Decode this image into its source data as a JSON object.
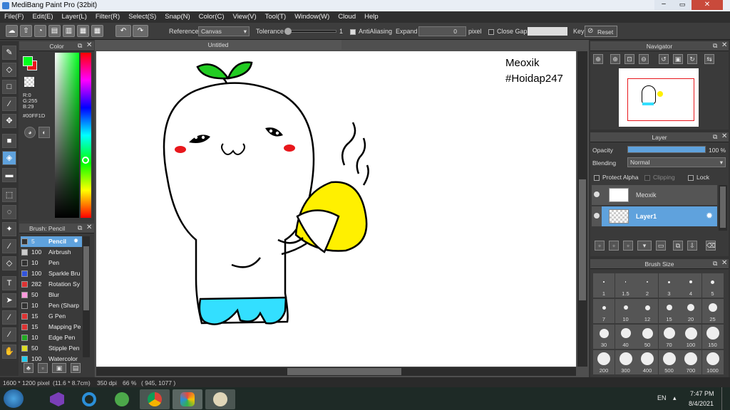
{
  "window": {
    "title": "MediBang Paint Pro (32bit)"
  },
  "menu": [
    "File(F)",
    "Edit(E)",
    "Layer(L)",
    "Filter(R)",
    "Select(S)",
    "Snap(N)",
    "Color(C)",
    "View(V)",
    "Tool(T)",
    "Window(W)",
    "Cloud",
    "Help"
  ],
  "toolbar": {
    "reference_label": "Reference",
    "reference_value": "Canvas",
    "tolerance_label": "Tolerance",
    "tolerance_value": "1",
    "antialiasing_label": "AntiAliasing",
    "expand_label": "Expand",
    "expand_value": "0",
    "expand_unit": "pixel",
    "close_gaps_label": "Close Gaps",
    "key_label": "Key",
    "reset_label": "Reset"
  },
  "color_panel": {
    "title": "Color",
    "r": "R:0",
    "g": "G:255",
    "b": "B:29",
    "hex": "#00FF1D",
    "primary_color": "#00FF1D",
    "secondary_color": "#E8171C"
  },
  "brush_panel": {
    "title": "Brush: Pencil",
    "items": [
      {
        "size": "5",
        "name": "Pencil",
        "color": "#333333"
      },
      {
        "size": "100",
        "name": "Airbrush",
        "color": "#cccccc"
      },
      {
        "size": "10",
        "name": "Pen",
        "color": "#333333"
      },
      {
        "size": "100",
        "name": "Sparkle Bru",
        "color": "#3355dd"
      },
      {
        "size": "282",
        "name": "Rotation Sy",
        "color": "#dd3333"
      },
      {
        "size": "50",
        "name": "Blur",
        "color": "#ff99dd"
      },
      {
        "size": "10",
        "name": "Pen (Sharp",
        "color": "#333333"
      },
      {
        "size": "15",
        "name": "G Pen",
        "color": "#dd3333"
      },
      {
        "size": "15",
        "name": "Mapping Pe",
        "color": "#dd3333"
      },
      {
        "size": "10",
        "name": "Edge Pen",
        "color": "#22aa22"
      },
      {
        "size": "50",
        "name": "Stipple Pen",
        "color": "#dddd22"
      },
      {
        "size": "100",
        "name": "Watercolor",
        "color": "#22ccee"
      }
    ]
  },
  "canvas": {
    "tab_title": "Untitled",
    "watermark_line1": "Meoxik",
    "watermark_line2": "#Hoidap247"
  },
  "navigator": {
    "title": "Navigator"
  },
  "layer_panel": {
    "title": "Layer",
    "opacity_label": "Opacity",
    "opacity_value": "100 %",
    "opacity_fraction": 1.0,
    "blending_label": "Blending",
    "blending_value": "Normal",
    "protect_alpha_label": "Protect Alpha",
    "clipping_label": "Clipping",
    "lock_label": "Lock",
    "layers": [
      {
        "name": "Meoxik",
        "selected": false
      },
      {
        "name": "Layer1",
        "selected": true
      }
    ]
  },
  "brush_size_panel": {
    "title": "Brush Size",
    "sizes": [
      "1",
      "1.5",
      "2",
      "3",
      "4",
      "5",
      "7",
      "10",
      "12",
      "15",
      "20",
      "25",
      "30",
      "40",
      "50",
      "70",
      "100",
      "150",
      "200",
      "300",
      "400",
      "500",
      "700",
      "1000"
    ]
  },
  "status": {
    "dims": "1600 * 1200 pixel",
    "cm": "(11.6 * 8.7cm)",
    "dpi": "350 dpi",
    "zoom": "66 %",
    "coords": "( 945, 1077 )"
  },
  "taskbar": {
    "lang": "EN",
    "time": "7:47 PM",
    "date": "8/4/2021"
  }
}
